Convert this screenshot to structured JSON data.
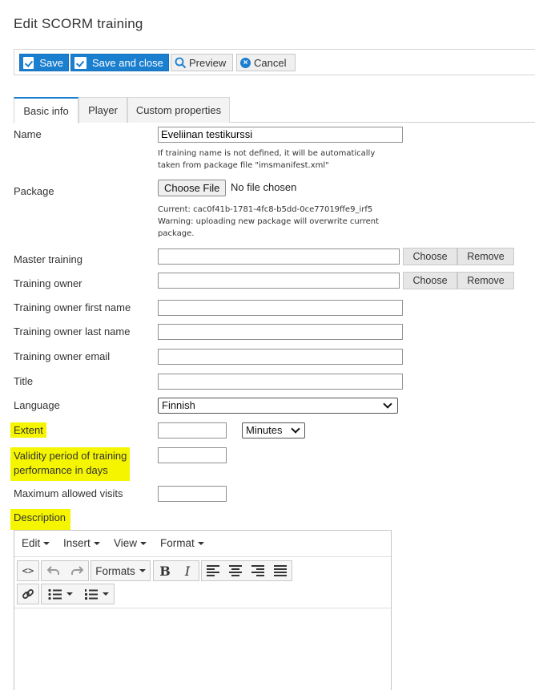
{
  "page": {
    "title": "Edit SCORM training"
  },
  "toolbar": {
    "save": "Save",
    "save_and_close": "Save and close",
    "preview": "Preview",
    "cancel": "Cancel"
  },
  "tabs": [
    "Basic info",
    "Player",
    "Custom properties"
  ],
  "form": {
    "name": {
      "label": "Name",
      "value": "Eveliinan testikurssi",
      "help_line1": "If training name is not defined, it will be automatically",
      "help_line2": "taken from package file \"imsmanifest.xml\""
    },
    "package": {
      "label": "Package",
      "choose_file": "Choose File",
      "no_file": "No file chosen",
      "current": "Current: cac0f41b-1781-4fc8-b5dd-0ce77019ffe9_irf5",
      "warning_line1": "Warning: uploading new package will overwrite current",
      "warning_line2": "package."
    },
    "master_training": {
      "label": "Master training",
      "value": "",
      "choose": "Choose",
      "remove": "Remove"
    },
    "training_owner": {
      "label": "Training owner",
      "value": "",
      "choose": "Choose",
      "remove": "Remove"
    },
    "owner_first_name": {
      "label": "Training owner first name",
      "value": ""
    },
    "owner_last_name": {
      "label": "Training owner last name",
      "value": ""
    },
    "owner_email": {
      "label": "Training owner email",
      "value": ""
    },
    "title": {
      "label": "Title",
      "value": ""
    },
    "language": {
      "label": "Language",
      "value": "Finnish"
    },
    "extent": {
      "label": "Extent",
      "value": "",
      "unit": "Minutes"
    },
    "validity": {
      "label_line1": "Validity period of training",
      "label_line2": "performance in days",
      "value": ""
    },
    "max_visits": {
      "label": "Maximum allowed visits",
      "value": ""
    },
    "description": {
      "label": "Description"
    }
  },
  "editor": {
    "menus": [
      "Edit",
      "Insert",
      "View",
      "Format"
    ],
    "formats": "Formats",
    "bold": "B",
    "italic": "I",
    "source": "<>"
  },
  "colors": {
    "accent": "#1b7fd0",
    "highlight": "#f5f500"
  }
}
